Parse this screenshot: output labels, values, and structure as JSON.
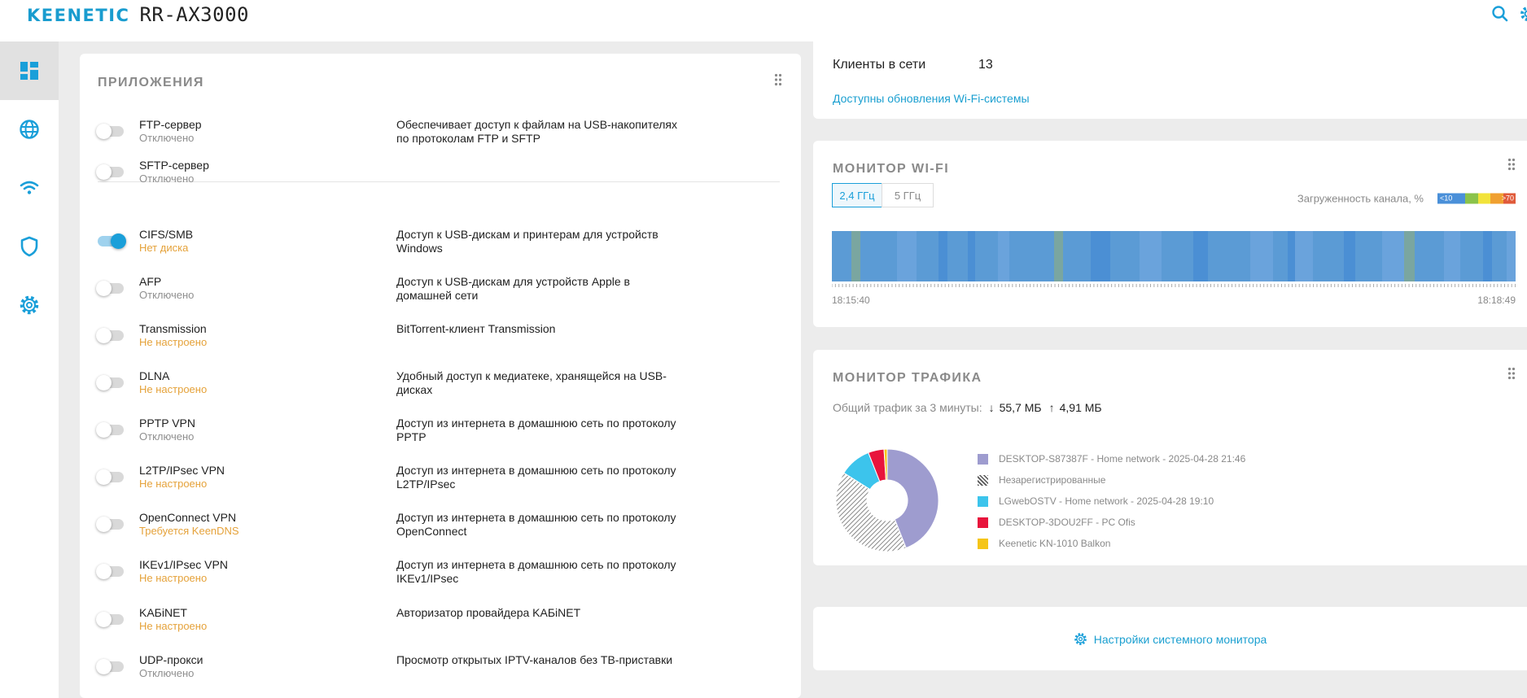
{
  "header": {
    "brand": "KEENETIC",
    "model": "RR-AX3000",
    "search_icon": "search-icon",
    "settings_icon": "gear-icon"
  },
  "sidebar": {
    "items": [
      {
        "icon": "dashboard-icon",
        "active": true
      },
      {
        "icon": "globe-icon"
      },
      {
        "icon": "wifi-icon"
      },
      {
        "icon": "shield-icon"
      },
      {
        "icon": "gear-icon"
      }
    ]
  },
  "apps": {
    "title": "ПРИЛОЖЕНИЯ",
    "items": [
      {
        "name": "FTP-сервер",
        "status": "Отключено",
        "status_type": "off",
        "desc": "Обеспечивает доступ к файлам на USB-накопителях по протоколам FTP и SFTP",
        "on": false
      },
      {
        "name": "SFTP-сервер",
        "status": "Отключено",
        "status_type": "off",
        "desc": "",
        "on": false
      },
      {
        "name": "CIFS/SMB",
        "status": "Нет диска",
        "status_type": "warn",
        "desc": "Доступ к USB-дискам и принтерам для устройств Windows",
        "on": true
      },
      {
        "name": "AFP",
        "status": "Отключено",
        "status_type": "off",
        "desc": "Доступ к USB-дискам для устройств Apple в домашней сети",
        "on": false
      },
      {
        "name": "Transmission",
        "status": "Не настроено",
        "status_type": "warn",
        "desc": "BitTorrent-клиент Transmission",
        "on": false
      },
      {
        "name": "DLNA",
        "status": "Не настроено",
        "status_type": "warn",
        "desc": "Удобный доступ к медиатеке, хранящейся на USB-дисках",
        "on": false
      },
      {
        "name": "PPTP VPN",
        "status": "Отключено",
        "status_type": "off",
        "desc": "Доступ из интернета в домашнюю сеть по протоколу PPTP",
        "on": false
      },
      {
        "name": "L2TP/IPsec VPN",
        "status": "Не настроено",
        "status_type": "warn",
        "desc": "Доступ из интернета в домашнюю сеть по протоколу L2TP/IPsec",
        "on": false
      },
      {
        "name": "OpenConnect VPN",
        "status": "Требуется KeenDNS",
        "status_type": "warn",
        "desc": "Доступ из интернета в домашнюю сеть по протоколу OpenConnect",
        "on": false
      },
      {
        "name": "IKEv1/IPsec VPN",
        "status": "Не настроено",
        "status_type": "warn",
        "desc": "Доступ из интернета в домашнюю сеть по протоколу IKEv1/IPsec",
        "on": false
      },
      {
        "name": "KAБiNET",
        "status": "Не настроено",
        "status_type": "warn",
        "desc": "Авторизатор провайдера KAБiNET",
        "on": false
      },
      {
        "name": "UDP-прокси",
        "status": "Отключено",
        "status_type": "off",
        "desc": "Просмотр открытых IPTV-каналов без ТВ-приставки",
        "on": false
      }
    ]
  },
  "clients": {
    "label": "Клиенты в сети",
    "count": "13",
    "update_link": "Доступны обновления Wi-Fi-системы"
  },
  "wifi_monitor": {
    "title": "МОНИТОР WI-FI",
    "band_24": "2,4 ГГц",
    "band_5": "5 ГГц",
    "load_label": "Загруженность канала, %",
    "legend_low": "<10",
    "legend_high": ">70",
    "legend_colors": [
      "#4a90d9",
      "#8bc34a",
      "#f2e33a",
      "#f0a030",
      "#e05a3a"
    ],
    "time_start": "18:15:40",
    "time_end": "18:18:49",
    "load_levels": [
      {
        "color": "#5b9bd5",
        "w": 26
      },
      {
        "color": "#7aa6a0",
        "w": 12
      },
      {
        "color": "#5b9bd5",
        "w": 50
      },
      {
        "color": "#6aa3dc",
        "w": 26
      },
      {
        "color": "#5b9bd5",
        "w": 30
      },
      {
        "color": "#4b8fd4",
        "w": 12
      },
      {
        "color": "#5b9bd5",
        "w": 28
      },
      {
        "color": "#4b8fd4",
        "w": 10
      },
      {
        "color": "#5b9bd5",
        "w": 30
      },
      {
        "color": "#6aa3dc",
        "w": 16
      },
      {
        "color": "#5b9bd5",
        "w": 60
      },
      {
        "color": "#7aa6a0",
        "w": 12
      },
      {
        "color": "#5b9bd5",
        "w": 38
      },
      {
        "color": "#4b8fd4",
        "w": 26
      },
      {
        "color": "#5b9bd5",
        "w": 40
      },
      {
        "color": "#6aa3dc",
        "w": 30
      },
      {
        "color": "#5b9bd5",
        "w": 42
      },
      {
        "color": "#4b8fd4",
        "w": 20
      },
      {
        "color": "#5b9bd5",
        "w": 58
      },
      {
        "color": "#6aa3dc",
        "w": 30
      },
      {
        "color": "#5b9bd5",
        "w": 20
      },
      {
        "color": "#4b8fd4",
        "w": 10
      },
      {
        "color": "#6aa3dc",
        "w": 24
      },
      {
        "color": "#5b9bd5",
        "w": 42
      },
      {
        "color": "#4b8fd4",
        "w": 16
      },
      {
        "color": "#5b9bd5",
        "w": 36
      },
      {
        "color": "#6aa3dc",
        "w": 30
      },
      {
        "color": "#7aa6a0",
        "w": 14
      },
      {
        "color": "#5b9bd5",
        "w": 40
      },
      {
        "color": "#6aa3dc",
        "w": 22
      },
      {
        "color": "#5b9bd5",
        "w": 30
      },
      {
        "color": "#4b8fd4",
        "w": 12
      },
      {
        "color": "#5b9bd5",
        "w": 20
      },
      {
        "color": "#6aa3dc",
        "w": 12
      }
    ]
  },
  "traffic_monitor": {
    "title": "МОНИТОР ТРАФИКА",
    "total_label": "Общий трафик за 3 минуты:",
    "down": "55,7 МБ",
    "up": "4,91 МБ",
    "legend": [
      {
        "label": "DESKTOP-S87387F - Home network - 2025-04-28 21:46",
        "color": "#9e9ccf",
        "pattern": false
      },
      {
        "label": "Незарегистрированные",
        "color": "#555555",
        "pattern": true
      },
      {
        "label": "LGwebOSTV - Home network - 2025-04-28 19:10",
        "color": "#3cc4ec",
        "pattern": false
      },
      {
        "label": "DESKTOP-3DOU2FF - PC Ofis",
        "color": "#e8143c",
        "pattern": false
      },
      {
        "label": "Keenetic KN-1010 Balkon",
        "color": "#f5c518",
        "pattern": false
      }
    ],
    "share": [
      0.44,
      0.4,
      0.1,
      0.05,
      0.01
    ]
  },
  "system_monitor": {
    "link": "Настройки системного монитора"
  }
}
